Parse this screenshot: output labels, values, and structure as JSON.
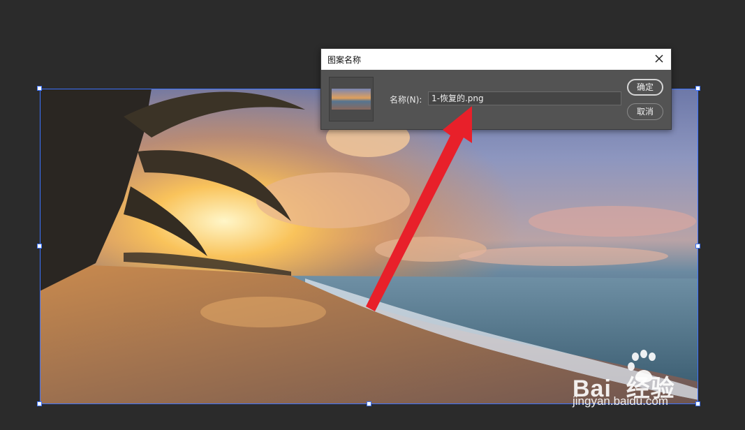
{
  "dialog": {
    "title": "图案名称",
    "name_label": "名称(N):",
    "name_value": "1-恢复的.png",
    "ok_label": "确定",
    "cancel_label": "取消"
  },
  "watermark": {
    "logo_text": "Bai  经验",
    "url": "jingyan.baidu.com"
  },
  "colors": {
    "canvas_bg": "#2b2b2b",
    "selection_accent": "#3c73ff",
    "dialog_bg": "#535353",
    "arrow": "#e8202a"
  },
  "icons": [
    "close-icon",
    "annotation-arrow",
    "paw-icon"
  ]
}
